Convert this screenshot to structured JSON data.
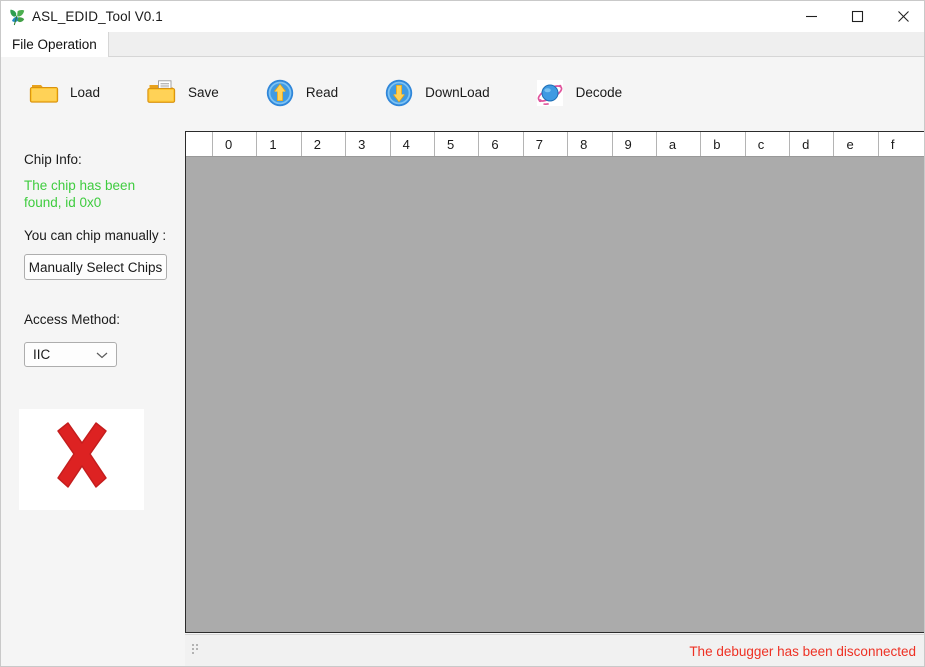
{
  "window": {
    "title": "ASL_EDID_Tool V0.1",
    "app_icon": "leaf-icon",
    "controls": [
      {
        "name": "minimize",
        "icon": "minimize-icon"
      },
      {
        "name": "maximize",
        "icon": "maximize-icon"
      },
      {
        "name": "close",
        "icon": "close-icon"
      }
    ]
  },
  "tabs": [
    {
      "label": "File Operation",
      "active": true
    }
  ],
  "toolbar": {
    "items": [
      {
        "id": "load",
        "label": "Load",
        "icon": "folder-open-icon"
      },
      {
        "id": "save",
        "label": "Save",
        "icon": "folder-save-document-icon"
      },
      {
        "id": "read",
        "label": "Read",
        "icon": "circle-arrow-up-icon"
      },
      {
        "id": "download",
        "label": "DownLoad",
        "icon": "circle-arrow-down-icon"
      },
      {
        "id": "decode",
        "label": "Decode",
        "icon": "planet-icon"
      }
    ]
  },
  "left_panel": {
    "chip_info_label": "Chip Info:",
    "chip_info_status": "The chip has been found, id 0x0",
    "chip_info_status_color": "#3fcc3f",
    "chip_manual_label": "You can chip manually :",
    "manual_select_button": "Manually Select Chips",
    "access_method_label": "Access Method:",
    "access_method_value": "IIC",
    "access_method_options": [
      "IIC"
    ],
    "status_image": {
      "icon": "red-cross-icon",
      "color": "#dd2222"
    }
  },
  "hex_grid": {
    "column_headers": [
      "0",
      "1",
      "2",
      "3",
      "4",
      "5",
      "6",
      "7",
      "8",
      "9",
      "a",
      "b",
      "c",
      "d",
      "e",
      "f"
    ],
    "rows": [],
    "body_color": "#ababab"
  },
  "statusbar": {
    "grip_icon": "resize-grip-icon",
    "message": "The debugger has been disconnected",
    "message_color": "#ee3124"
  }
}
